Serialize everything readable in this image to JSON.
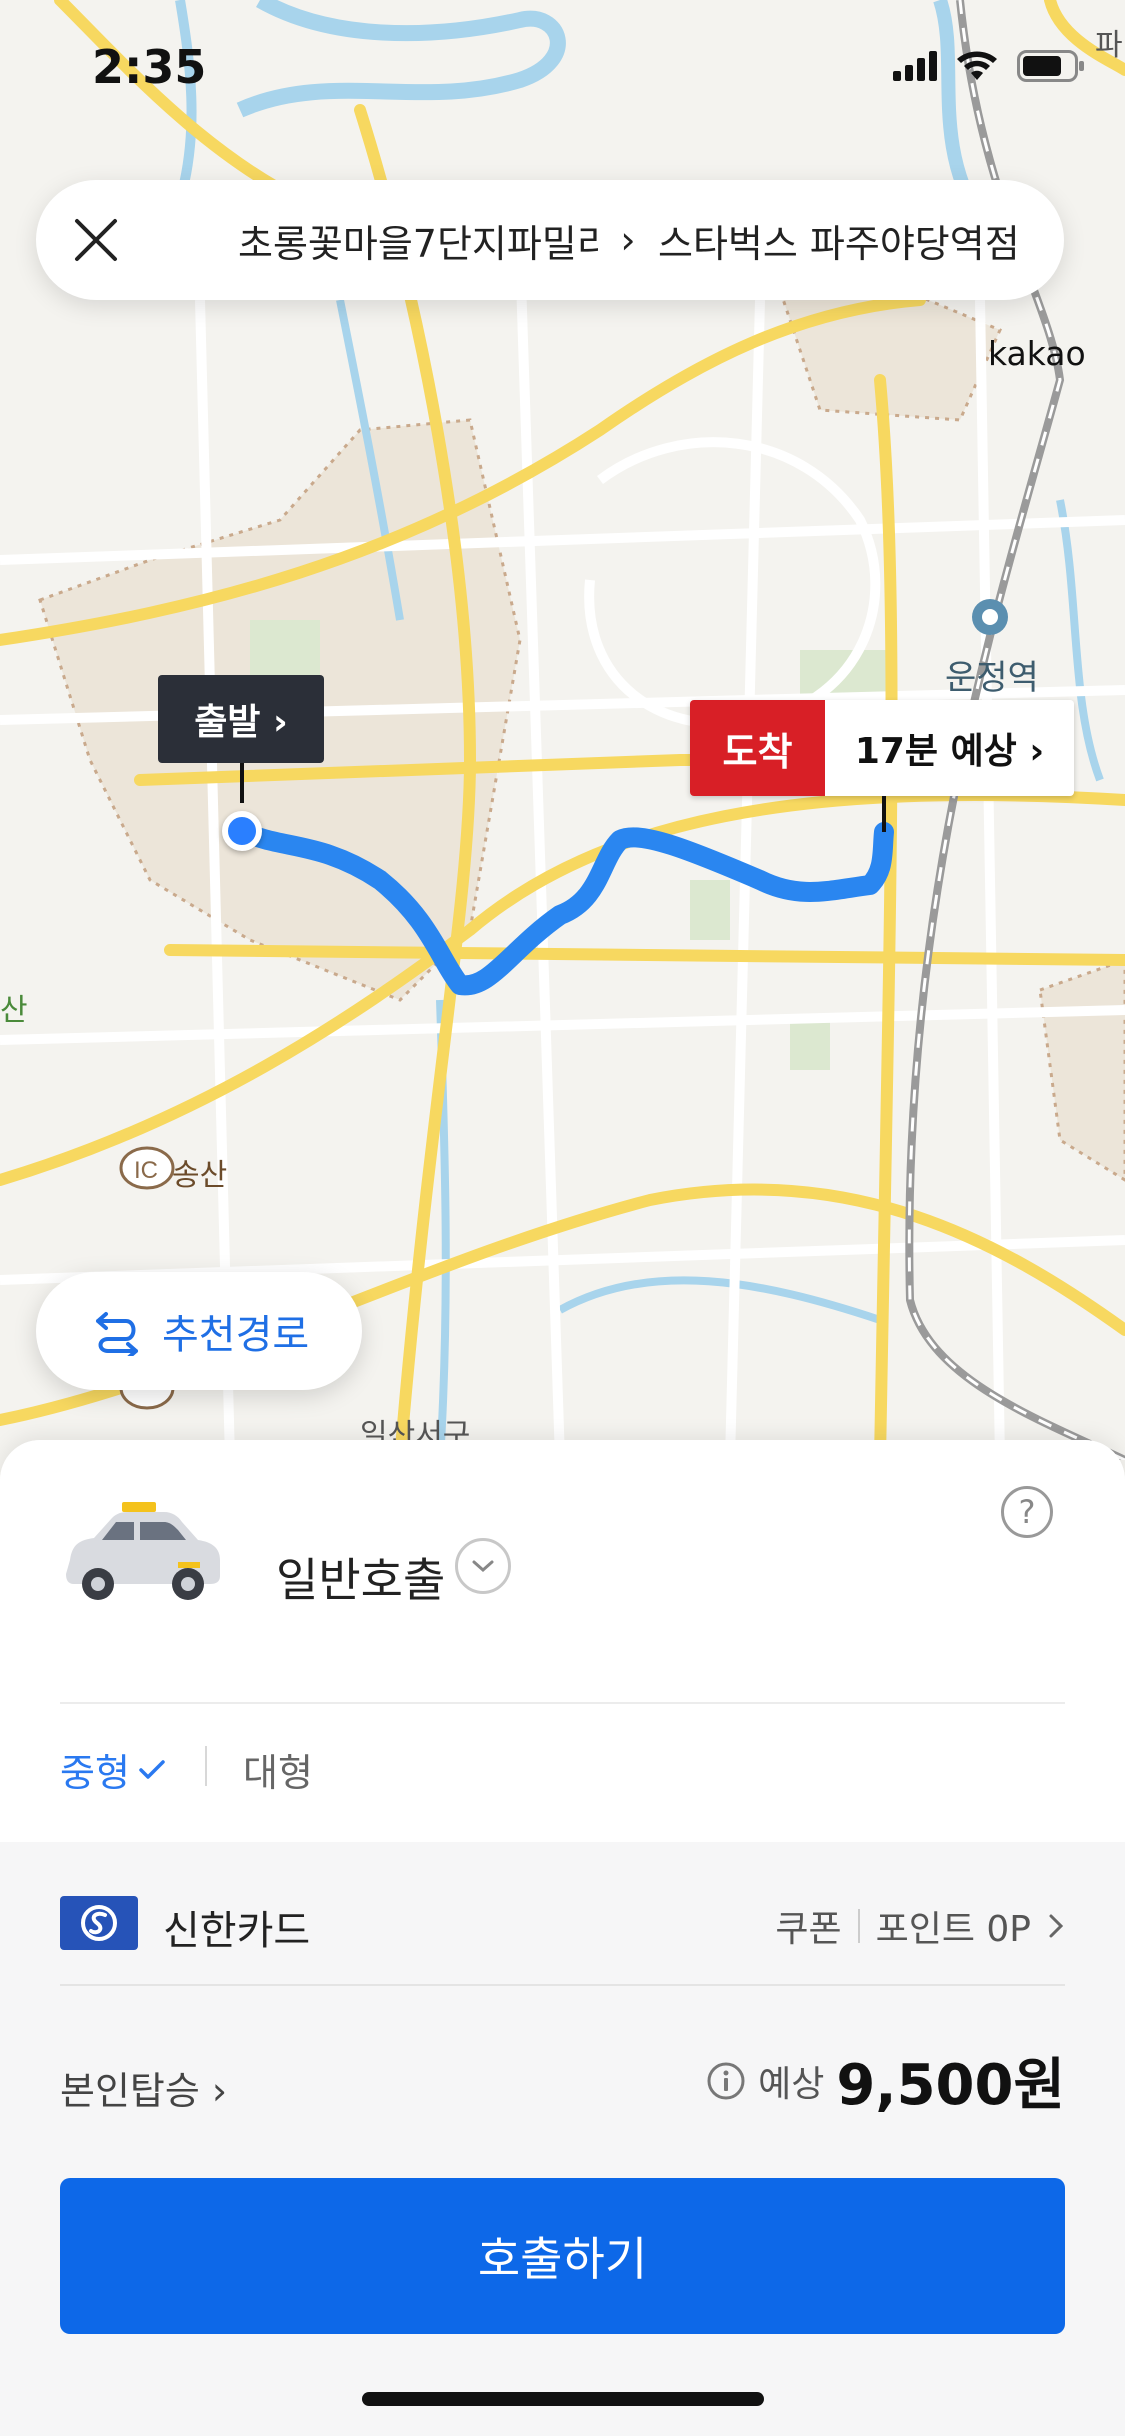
{
  "status_bar": {
    "time": "2:35"
  },
  "route_bar": {
    "origin": "초롱꽃마을7단지파밀리",
    "separator": "›",
    "destination": "스타벅스 파주야당역점"
  },
  "map": {
    "brand": "kakao",
    "place_labels": [
      "송산",
      "일산서구",
      "파",
      "산"
    ],
    "interchange_label": "IC",
    "station_label": "운정역",
    "start_label": "출발 ›",
    "arrive_tag": "도착",
    "arrive_eta": "17분 예상 ›",
    "colors": {
      "route": "#2a86f0",
      "start_dot": "#2a7fff",
      "arrive_tag": "#d81f26"
    }
  },
  "recommend_button": {
    "label": "추천경로"
  },
  "sheet": {
    "help": "?",
    "call_type": "일반호출",
    "size_options": [
      {
        "label": "중형",
        "selected": true
      },
      {
        "label": "대형",
        "selected": false
      }
    ],
    "payment": {
      "card_name": "신한카드",
      "coupon": "쿠폰",
      "points": "포인트 0P"
    },
    "ride_option": "본인탑승 ›",
    "price_label": "예상",
    "price_value": "9,500원",
    "call_button": "호출하기"
  }
}
